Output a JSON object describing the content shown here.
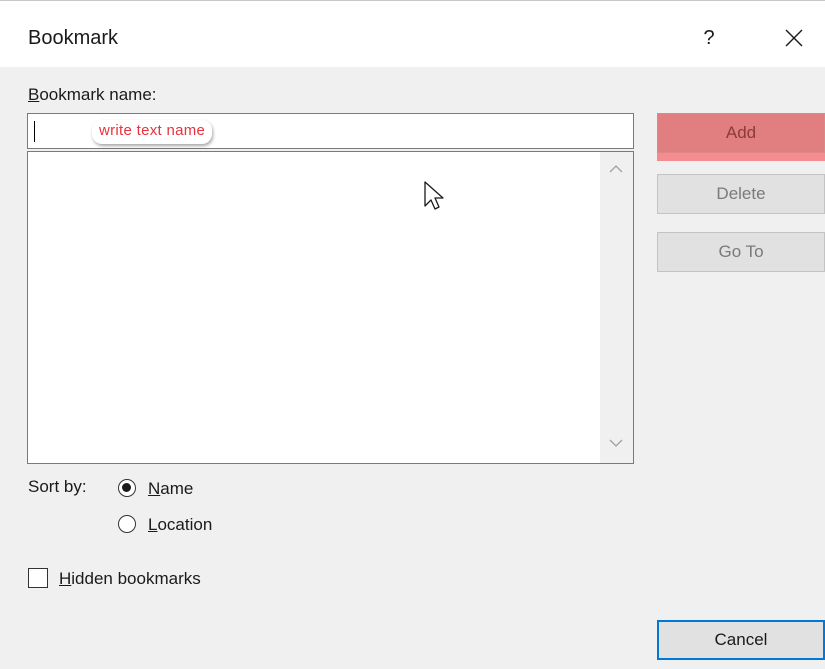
{
  "dialog": {
    "title": "Bookmark",
    "help_label": "?",
    "close_icon": "close-icon"
  },
  "name_field": {
    "label_first": "B",
    "label_rest": "ookmark name:",
    "value": "",
    "annotation": "write text name"
  },
  "bookmark_list": {
    "items": [],
    "scroll_up_icon": "chevron-up-icon",
    "scroll_down_icon": "chevron-down-icon"
  },
  "buttons": {
    "add": "Add",
    "delete": "Delete",
    "goto": "Go To",
    "cancel": "Cancel"
  },
  "sort": {
    "label": "Sort by:",
    "options": [
      {
        "first": "N",
        "rest": "ame",
        "selected": true
      },
      {
        "first": "L",
        "rest": "ocation",
        "selected": false
      }
    ]
  },
  "hidden_bookmarks": {
    "first": "H",
    "rest": "idden bookmarks",
    "checked": false
  },
  "colors": {
    "highlight": "#e17f80",
    "annotation_text": "#e8323c",
    "focus_border": "#0078d7"
  }
}
